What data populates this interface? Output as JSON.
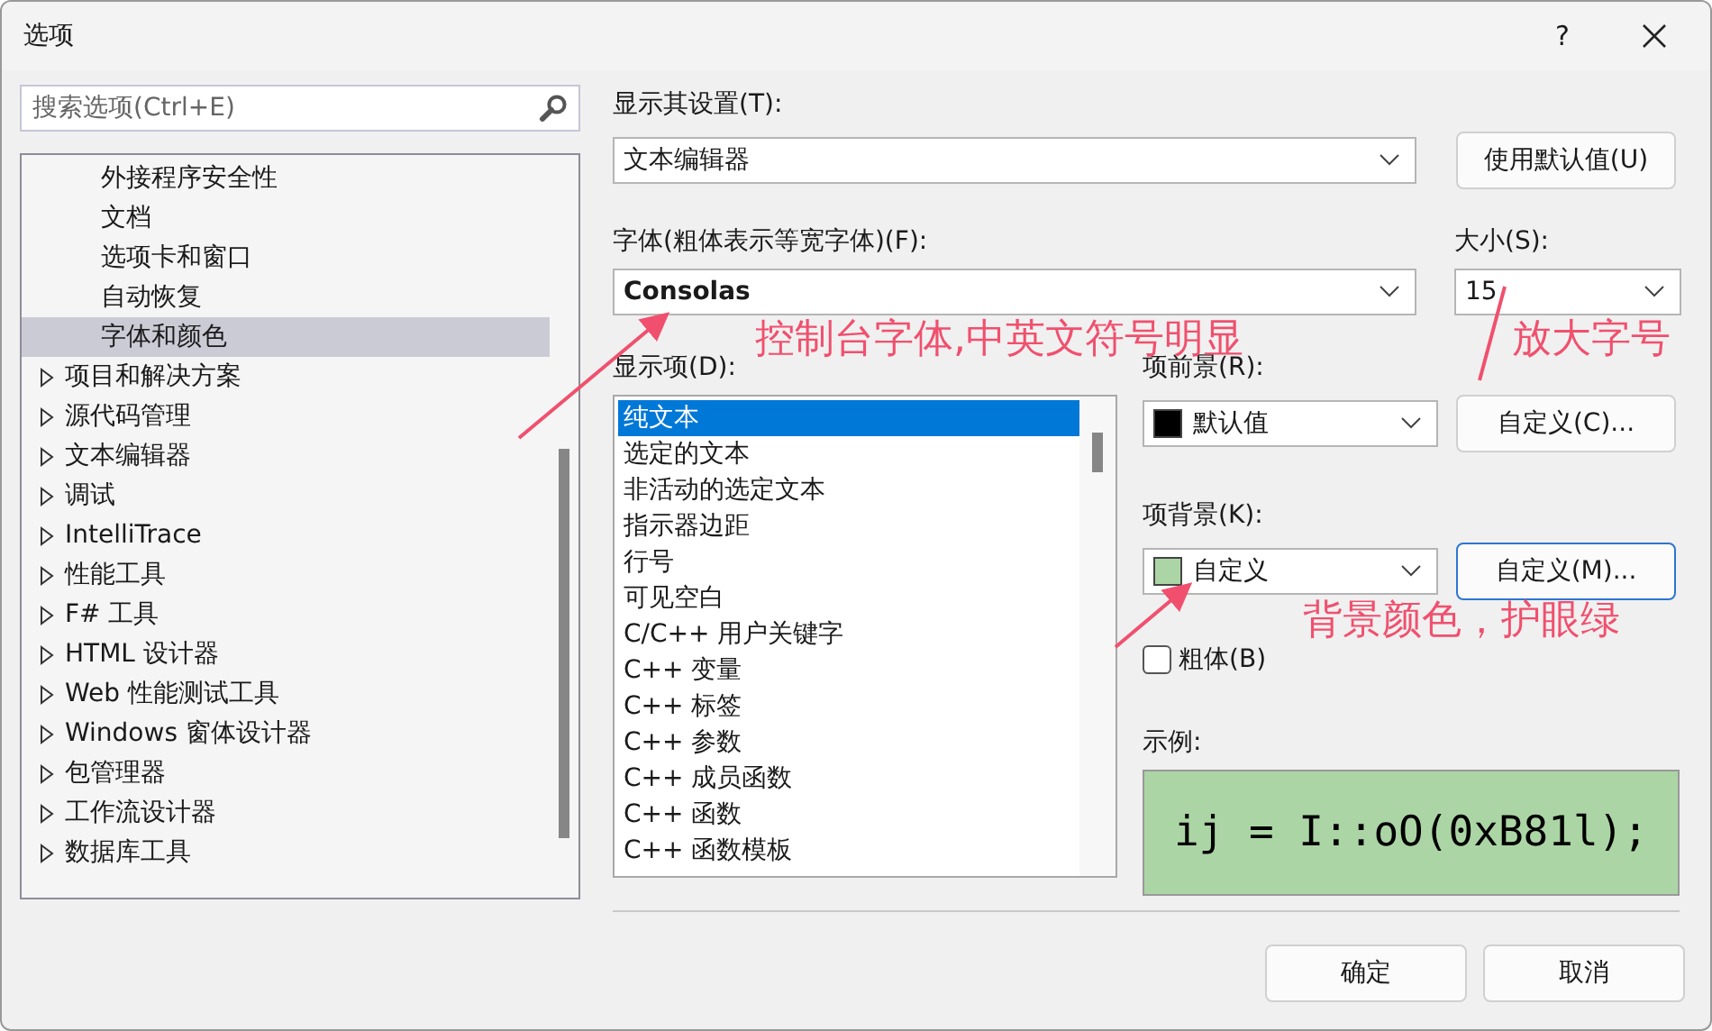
{
  "window": {
    "title": "选项",
    "help": "?"
  },
  "search": {
    "placeholder": "搜索选项(Ctrl+E)"
  },
  "tree": [
    {
      "label": "外接程序安全性",
      "kind": "child",
      "selected": false
    },
    {
      "label": "文档",
      "kind": "child",
      "selected": false
    },
    {
      "label": "选项卡和窗口",
      "kind": "child",
      "selected": false
    },
    {
      "label": "自动恢复",
      "kind": "child",
      "selected": false
    },
    {
      "label": "字体和颜色",
      "kind": "child",
      "selected": true
    },
    {
      "label": "项目和解决方案",
      "kind": "group",
      "selected": false
    },
    {
      "label": "源代码管理",
      "kind": "group",
      "selected": false
    },
    {
      "label": "文本编辑器",
      "kind": "group",
      "selected": false
    },
    {
      "label": "调试",
      "kind": "group",
      "selected": false
    },
    {
      "label": "IntelliTrace",
      "kind": "group",
      "selected": false
    },
    {
      "label": "性能工具",
      "kind": "group",
      "selected": false
    },
    {
      "label": "F# 工具",
      "kind": "group",
      "selected": false
    },
    {
      "label": "HTML 设计器",
      "kind": "group",
      "selected": false
    },
    {
      "label": "Web 性能测试工具",
      "kind": "group",
      "selected": false
    },
    {
      "label": "Windows 窗体设计器",
      "kind": "group",
      "selected": false
    },
    {
      "label": "包管理器",
      "kind": "group",
      "selected": false
    },
    {
      "label": "工作流设计器",
      "kind": "group",
      "selected": false
    },
    {
      "label": "数据库工具",
      "kind": "group",
      "selected": false
    }
  ],
  "show_settings_for": {
    "label": "显示其设置(T):",
    "value": "文本编辑器",
    "button": "使用默认值(U)"
  },
  "font": {
    "label": "字体(粗体表示等宽字体)(F):",
    "value": "Consolas"
  },
  "size": {
    "label": "大小(S):",
    "value": "15"
  },
  "display_items": {
    "label": "显示项(D):",
    "items": [
      {
        "label": "纯文本",
        "selected": true
      },
      {
        "label": "选定的文本",
        "selected": false
      },
      {
        "label": "非活动的选定文本",
        "selected": false
      },
      {
        "label": "指示器边距",
        "selected": false
      },
      {
        "label": "行号",
        "selected": false
      },
      {
        "label": "可见空白",
        "selected": false
      },
      {
        "label": "C/C++ 用户关键字",
        "selected": false
      },
      {
        "label": "C++ 变量",
        "selected": false
      },
      {
        "label": "C++ 标签",
        "selected": false
      },
      {
        "label": "C++ 参数",
        "selected": false
      },
      {
        "label": "C++ 成员函数",
        "selected": false
      },
      {
        "label": "C++ 函数",
        "selected": false
      },
      {
        "label": "C++ 函数模板",
        "selected": false
      }
    ]
  },
  "foreground": {
    "label": "项前景(R):",
    "value": "默认值",
    "color": "#000000",
    "button": "自定义(C)...",
    "focused": false
  },
  "background": {
    "label": "项背景(K):",
    "value": "自定义",
    "color": "#acd5a5",
    "button": "自定义(M)...",
    "focused": true
  },
  "bold": {
    "label": "粗体(B)",
    "checked": false
  },
  "sample": {
    "label": "示例:",
    "text": "ij = I::oO(0xB81l);"
  },
  "buttons": [
    {
      "label": "确定"
    },
    {
      "label": "取消"
    }
  ],
  "annotations": [
    {
      "text": "控制台字体,中英文符号明显"
    },
    {
      "text": "放大字号"
    },
    {
      "text": "背景颜色，护眼绿"
    }
  ]
}
